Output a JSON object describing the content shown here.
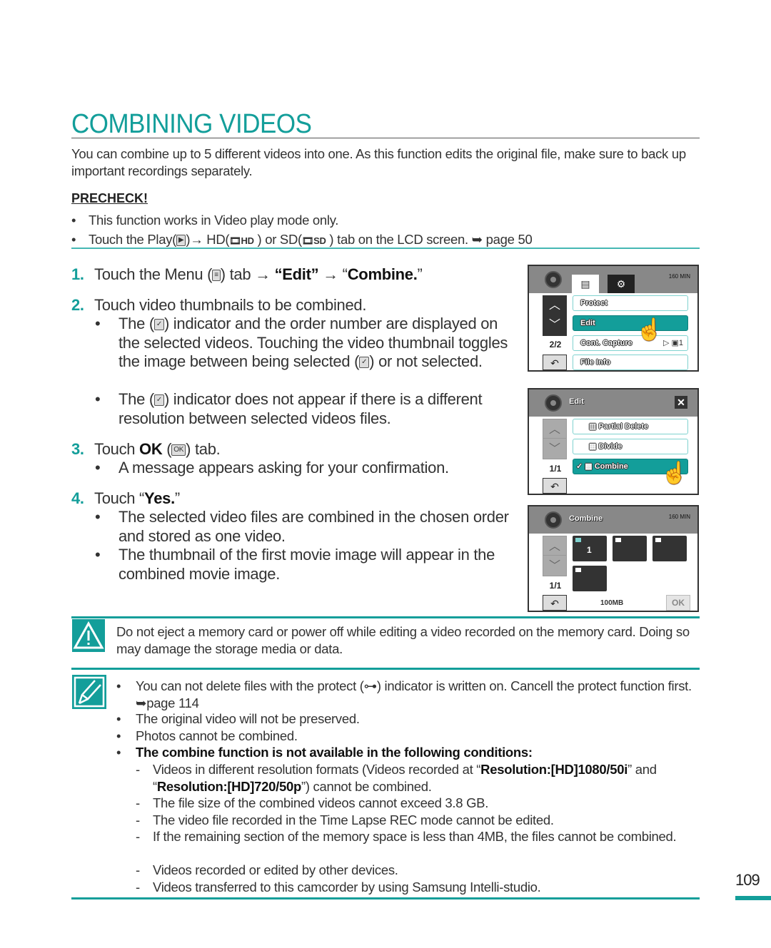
{
  "title": "COMBINING VIDEOS",
  "intro": "You can combine up to 5 different videos into one. As this function edits the original file, make sure to back up important recordings separately.",
  "precheck": {
    "heading": "PRECHECK!",
    "items": [
      "This function works in Video play mode only.",
      {
        "pre": "Touch the Play(",
        "play_icon": "▶",
        "mid1": ")→ HD(",
        "hd": "HD",
        "mid2": " ) or SD(",
        "sd": "SD",
        "post": " ) tab on the LCD screen. ➥ page 50"
      }
    ]
  },
  "steps": [
    {
      "num": "1.",
      "pre": "Touch the Menu (",
      "menu_icon": "≡",
      "mid": ") tab → ",
      "b1": "“Edit”",
      "arrow": " → “",
      "b2": "Combine.",
      "end": "”"
    },
    {
      "num": "2.",
      "text": "Touch video thumbnails to be combined.",
      "bullets": [
        {
          "pre": "The (",
          "icon": "✓",
          "post": ") indicator and the order number are displayed on the selected videos. Touching the video thumbnail toggles the image between being selected (",
          "icon2": "✓",
          "post2": ") or not selected."
        },
        {
          "pre": "The (",
          "icon": "✓",
          "post": ") indicator does not appear if there is a different resolution between selected videos files."
        }
      ]
    },
    {
      "num": "3.",
      "pre": "Touch ",
      "bold": "OK",
      "mid": " (",
      "ok_icon": "OK",
      "post": ") tab.",
      "bullets": [
        "A message appears asking for your confirmation."
      ]
    },
    {
      "num": "4.",
      "pre": "Touch “",
      "bold": "Yes.",
      "post": "”",
      "bullets": [
        "The selected video files are combined in the chosen order and stored as one video.",
        "The thumbnail of the first movie image will appear in the combined movie image."
      ]
    }
  ],
  "lcd1": {
    "tabs": [
      "menu-icon",
      "gear-icon"
    ],
    "battery": "160 MIN",
    "page": "2/2",
    "items": [
      {
        "label": "Protect",
        "selected": false
      },
      {
        "label": "Edit",
        "selected": true
      },
      {
        "label": "Cont. Capture",
        "selected": false,
        "extra": "▷ ▣1"
      },
      {
        "label": "File Info",
        "selected": false
      }
    ]
  },
  "lcd2": {
    "title": "Edit",
    "page": "1/1",
    "items": [
      {
        "label": "Partial Delete",
        "selected": false
      },
      {
        "label": "Divide",
        "selected": false
      },
      {
        "label": "Combine",
        "selected": true
      }
    ]
  },
  "lcd3": {
    "title": "Combine",
    "battery": "160 MIN",
    "page": "1/1",
    "storage": "100MB",
    "ok": "OK",
    "thumbnails": [
      {
        "checked": true,
        "order": "1"
      },
      {
        "checked": false,
        "order": ""
      },
      {
        "checked": false,
        "order": ""
      },
      {
        "checked": false,
        "order": ""
      }
    ]
  },
  "warning": "Do not eject a memory card or power off while editing a video recorded on the memory card. Doing so may damage the storage media or data.",
  "notes": {
    "bullets": [
      {
        "pre": "You can not delete files with the protect (",
        "icon": "⊶",
        "post": ") indicator is written on. Cancell the protect function first. ➥page 114"
      },
      "The original video will not be preserved.",
      "Photos cannot be combined.",
      "The combine function is not available in the following conditions:"
    ],
    "conditions": [
      {
        "pre": "Videos in different resolution formats (Videos recorded at “",
        "b1": "Resolution:[HD]1080/50i",
        "mid": "” and “",
        "b2": "Resolution:[HD]720/50p",
        "post": "”) cannot be combined."
      },
      "The file size of the combined videos cannot exceed 3.8 GB.",
      "The video file recorded in the Time Lapse REC mode cannot be edited.",
      "If the remaining section of the memory space is less than 4MB, the files cannot be combined.",
      "Videos recorded or edited by other devices.",
      "Videos transferred to this camcorder by using Samsung Intelli-studio."
    ]
  },
  "page_number": "109",
  "colors": {
    "accent": "#139e9a"
  }
}
